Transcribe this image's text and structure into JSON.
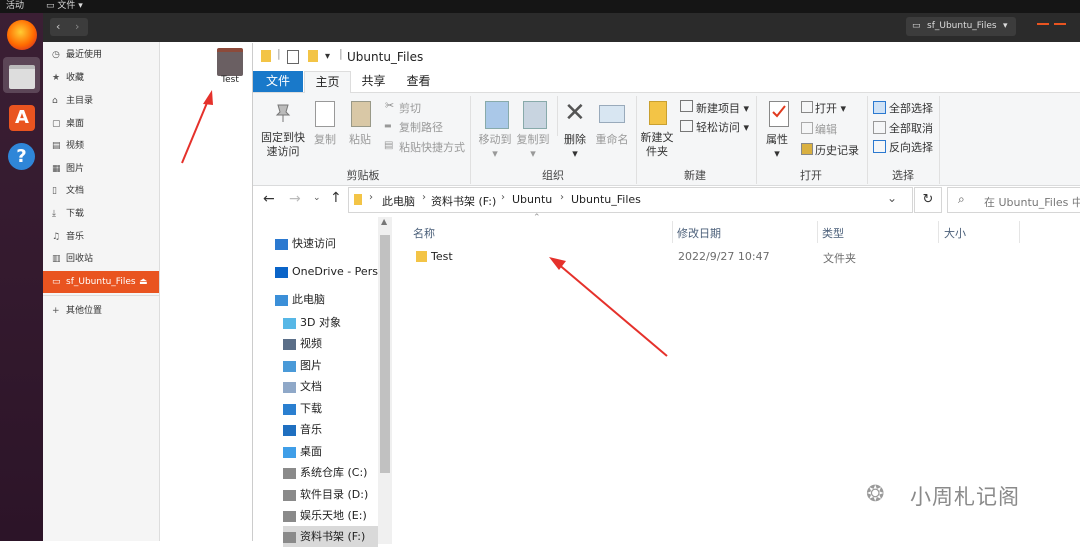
{
  "topbar": {
    "activities": "活动",
    "app_menu": "文件 ▾"
  },
  "nautilus": {
    "window_title": "sf_Ubuntu_Files",
    "sidebar": [
      {
        "icon": "clock-icon",
        "glyph": "◷",
        "label": "最近使用"
      },
      {
        "icon": "star-icon",
        "glyph": "★",
        "label": "收藏"
      },
      {
        "icon": "home-icon",
        "glyph": "⌂",
        "label": "主目录"
      },
      {
        "icon": "desktop-icon",
        "glyph": "▢",
        "label": "桌面"
      },
      {
        "icon": "video-icon",
        "glyph": "▤",
        "label": "视频"
      },
      {
        "icon": "picture-icon",
        "glyph": "▦",
        "label": "图片"
      },
      {
        "icon": "document-icon",
        "glyph": "▯",
        "label": "文档"
      },
      {
        "icon": "download-icon",
        "glyph": "⤓",
        "label": "下载"
      },
      {
        "icon": "music-icon",
        "glyph": "♫",
        "label": "音乐"
      },
      {
        "icon": "trash-icon",
        "glyph": "▥",
        "label": "回收站"
      },
      {
        "icon": "drive-icon",
        "glyph": "▭",
        "label": "sf_Ubuntu_Files",
        "eject": "⏏"
      },
      {
        "icon": "plus-icon",
        "glyph": "+",
        "label": "其他位置"
      }
    ],
    "folder_label": "Test"
  },
  "explorer": {
    "title": "Ubuntu_Files",
    "tabs": [
      "文件",
      "主页",
      "共享",
      "查看"
    ],
    "ribbon": {
      "pin": "固定到快速访问",
      "copy": "复制",
      "paste": "粘贴",
      "cut": "剪切",
      "copy_path": "复制路径",
      "paste_shortcut": "粘贴快捷方式",
      "clipboard_group": "剪贴板",
      "move_to": "移动到",
      "copy_to": "复制到",
      "delete": "删除",
      "rename": "重命名",
      "organize_group": "组织",
      "new_folder": "新建文件夹",
      "new_item": "新建项目 ▾",
      "easy_access": "轻松访问 ▾",
      "new_group": "新建",
      "properties": "属性",
      "open": "打开 ▾",
      "edit": "编辑",
      "history": "历史记录",
      "open_group": "打开",
      "select_all": "全部选择",
      "select_none": "全部取消",
      "invert": "反向选择",
      "select_group": "选择"
    },
    "breadcrumb": [
      "此电脑",
      "资料书架 (F:)",
      "Ubuntu",
      "Ubuntu_Files"
    ],
    "search_placeholder": "在 Ubuntu_Files 中",
    "nav": [
      {
        "label": "快速访问",
        "icon": "star-icon",
        "color": "#2b79d0"
      },
      {
        "label": "OneDrive - Persc",
        "icon": "cloud-icon",
        "color": "#0a64c8"
      },
      {
        "label": "此电脑",
        "icon": "computer-icon",
        "color": "#3b8fd8"
      },
      {
        "label": "3D 对象",
        "icon": "cube-icon",
        "color": "#57b7e6"
      },
      {
        "label": "视频",
        "icon": "video-icon",
        "color": "#5a6e88"
      },
      {
        "label": "图片",
        "icon": "picture-icon",
        "color": "#4a9ad8"
      },
      {
        "label": "文档",
        "icon": "document-icon",
        "color": "#8fa8c8"
      },
      {
        "label": "下载",
        "icon": "download-icon",
        "color": "#2a7fd0"
      },
      {
        "label": "音乐",
        "icon": "music-icon",
        "color": "#1f6fc0"
      },
      {
        "label": "桌面",
        "icon": "desktop-icon",
        "color": "#3f9ee8"
      },
      {
        "label": "系统仓库 (C:)",
        "icon": "drive-icon",
        "color": "#8a8a8a"
      },
      {
        "label": "软件目录 (D:)",
        "icon": "drive-icon",
        "color": "#8a8a8a"
      },
      {
        "label": "娱乐天地 (E:)",
        "icon": "drive-icon",
        "color": "#8a8a8a"
      },
      {
        "label": "资料书架 (F:)",
        "icon": "drive-icon",
        "color": "#8a8a8a"
      }
    ],
    "columns": [
      "名称",
      "修改日期",
      "类型",
      "大小"
    ],
    "files": [
      {
        "name": "Test",
        "modified": "2022/9/27 10:47",
        "type": "文件夹",
        "size": ""
      }
    ]
  },
  "watermark": "小周札记阁",
  "colors": {
    "ubuntu_orange": "#e95420",
    "win_blue": "#1979ca",
    "arrow_red": "#e5312b"
  }
}
